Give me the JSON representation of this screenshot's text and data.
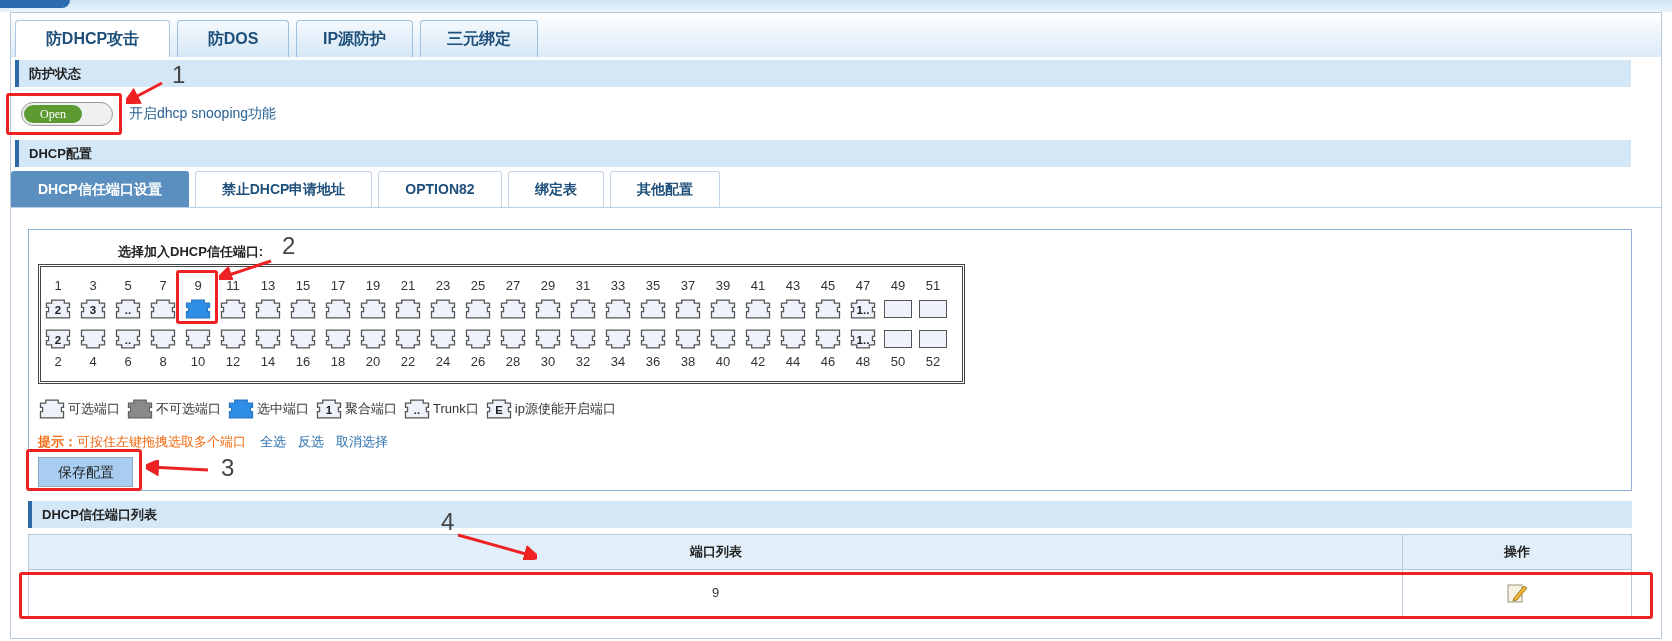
{
  "top_tabs": [
    {
      "label": "防DHCP攻击",
      "selected": true
    },
    {
      "label": "防DOS",
      "selected": false
    },
    {
      "label": "IP源防护",
      "selected": false
    },
    {
      "label": "三元绑定",
      "selected": false
    }
  ],
  "protection_section": {
    "title": "防护状态",
    "toggle": {
      "text": "Open",
      "on": true
    },
    "description": "开启dhcp snooping功能"
  },
  "dhcp_section": {
    "title": "DHCP配置",
    "sub_tabs": [
      {
        "label": "DHCP信任端口设置",
        "selected": true
      },
      {
        "label": "禁止DHCP申请地址",
        "selected": false
      },
      {
        "label": "OPTION82",
        "selected": false
      },
      {
        "label": "绑定表",
        "selected": false
      },
      {
        "label": "其他配置",
        "selected": false
      }
    ],
    "port_panel": {
      "title": "选择加入DHCP信任端口:",
      "columns": [
        {
          "kind": "copper",
          "top": {
            "number": "1",
            "badge": "2",
            "selected": false
          },
          "bottom": {
            "number": "2",
            "badge": "2",
            "selected": false
          }
        },
        {
          "kind": "copper",
          "top": {
            "number": "3",
            "badge": "3",
            "selected": false
          },
          "bottom": {
            "number": "4",
            "selected": false
          }
        },
        {
          "kind": "copper",
          "top": {
            "number": "5",
            "badge": "..",
            "selected": false
          },
          "bottom": {
            "number": "6",
            "badge": "..",
            "selected": false
          }
        },
        {
          "kind": "copper",
          "top": {
            "number": "7",
            "selected": false
          },
          "bottom": {
            "number": "8",
            "selected": false
          }
        },
        {
          "kind": "copper",
          "top": {
            "number": "9",
            "selected": true
          },
          "bottom": {
            "number": "10",
            "selected": false
          }
        },
        {
          "kind": "copper",
          "top": {
            "number": "11",
            "selected": false
          },
          "bottom": {
            "number": "12",
            "selected": false
          }
        },
        {
          "kind": "copper",
          "top": {
            "number": "13",
            "selected": false
          },
          "bottom": {
            "number": "14",
            "selected": false
          }
        },
        {
          "kind": "copper",
          "top": {
            "number": "15",
            "selected": false
          },
          "bottom": {
            "number": "16",
            "selected": false
          }
        },
        {
          "kind": "copper",
          "top": {
            "number": "17",
            "selected": false
          },
          "bottom": {
            "number": "18",
            "selected": false
          }
        },
        {
          "kind": "copper",
          "top": {
            "number": "19",
            "selected": false
          },
          "bottom": {
            "number": "20",
            "selected": false
          }
        },
        {
          "kind": "copper",
          "top": {
            "number": "21",
            "selected": false
          },
          "bottom": {
            "number": "22",
            "selected": false
          }
        },
        {
          "kind": "copper",
          "top": {
            "number": "23",
            "selected": false
          },
          "bottom": {
            "number": "24",
            "selected": false
          }
        },
        {
          "kind": "copper",
          "top": {
            "number": "25",
            "selected": false
          },
          "bottom": {
            "number": "26",
            "selected": false
          }
        },
        {
          "kind": "copper",
          "top": {
            "number": "27",
            "selected": false
          },
          "bottom": {
            "number": "28",
            "selected": false
          }
        },
        {
          "kind": "copper",
          "top": {
            "number": "29",
            "selected": false
          },
          "bottom": {
            "number": "30",
            "selected": false
          }
        },
        {
          "kind": "copper",
          "top": {
            "number": "31",
            "selected": false
          },
          "bottom": {
            "number": "32",
            "selected": false
          }
        },
        {
          "kind": "copper",
          "top": {
            "number": "33",
            "selected": false
          },
          "bottom": {
            "number": "34",
            "selected": false
          }
        },
        {
          "kind": "copper",
          "top": {
            "number": "35",
            "selected": false
          },
          "bottom": {
            "number": "36",
            "selected": false
          }
        },
        {
          "kind": "copper",
          "top": {
            "number": "37",
            "selected": false
          },
          "bottom": {
            "number": "38",
            "selected": false
          }
        },
        {
          "kind": "copper",
          "top": {
            "number": "39",
            "selected": false
          },
          "bottom": {
            "number": "40",
            "selected": false
          }
        },
        {
          "kind": "copper",
          "top": {
            "number": "41",
            "selected": false
          },
          "bottom": {
            "number": "42",
            "selected": false
          }
        },
        {
          "kind": "copper",
          "top": {
            "number": "43",
            "selected": false
          },
          "bottom": {
            "number": "44",
            "selected": false
          }
        },
        {
          "kind": "copper",
          "top": {
            "number": "45",
            "selected": false
          },
          "bottom": {
            "number": "46",
            "selected": false
          }
        },
        {
          "kind": "copper",
          "top": {
            "number": "47",
            "badge": "1..",
            "selected": false
          },
          "bottom": {
            "number": "48",
            "badge": "1..",
            "selected": false
          }
        },
        {
          "kind": "fiber",
          "top": {
            "number": "49",
            "selected": false
          },
          "bottom": {
            "number": "50",
            "selected": false
          }
        },
        {
          "kind": "fiber",
          "top": {
            "number": "51",
            "selected": false
          },
          "bottom": {
            "number": "52",
            "selected": false
          }
        }
      ],
      "legend": [
        {
          "kind": "available",
          "label": "可选端口"
        },
        {
          "kind": "unavailable",
          "label": "不可选端口"
        },
        {
          "kind": "selected",
          "label": "选中端口"
        },
        {
          "kind": "aggregate",
          "badge": "1",
          "label": "聚合端口"
        },
        {
          "kind": "trunk",
          "badge": "..",
          "label": "Trunk口"
        },
        {
          "kind": "ip_source",
          "badge": "E",
          "label": "ip源使能开启端口"
        }
      ],
      "hint": "**提示：**可按住左键拖拽选取多个端口",
      "links": [
        "全选",
        "反选",
        "取消选择"
      ],
      "save_button": "保存配置"
    },
    "trusted_list": {
      "title": "DHCP信任端口列表",
      "columns": [
        "端口列表",
        "操作"
      ],
      "rows": [
        {
          "ports": "9"
        }
      ]
    }
  },
  "annotations": [
    {
      "number": "1"
    },
    {
      "number": "2"
    },
    {
      "number": "3"
    },
    {
      "number": "4"
    }
  ]
}
